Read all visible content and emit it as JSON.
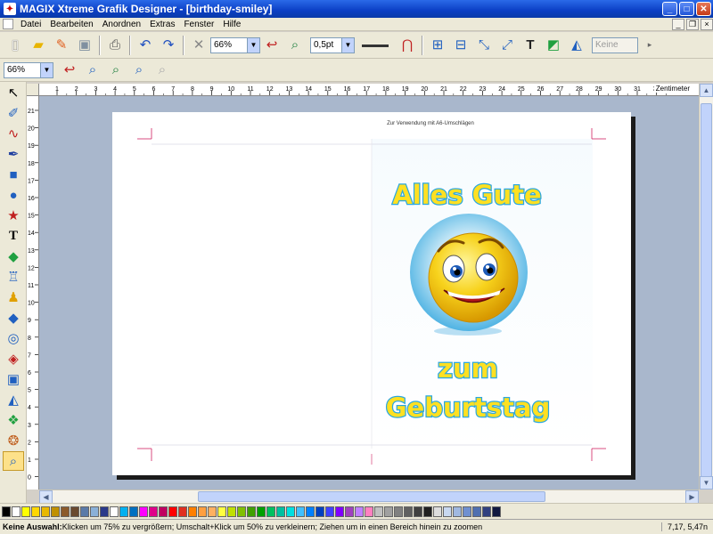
{
  "window": {
    "title": "MAGIX Xtreme Grafik Designer - [birthday-smiley]"
  },
  "menu": {
    "items": [
      "Datei",
      "Bearbeiten",
      "Anordnen",
      "Extras",
      "Fenster",
      "Hilfe"
    ]
  },
  "toolbar1": {
    "zoom": "66%",
    "line_width": "0,5pt",
    "style": "Keine"
  },
  "toolbar2": {
    "zoom": "66%"
  },
  "ruler": {
    "unit": "Zentimeter",
    "h_ticks": [
      "1",
      "2",
      "3",
      "4",
      "5",
      "6",
      "7",
      "8",
      "9",
      "10",
      "11",
      "12",
      "13",
      "14",
      "15",
      "16",
      "17",
      "18",
      "19",
      "20",
      "21",
      "22",
      "23",
      "24",
      "25",
      "26",
      "27",
      "28",
      "29",
      "30",
      "31",
      "32"
    ],
    "v_ticks": [
      "21",
      "20",
      "19",
      "18",
      "17",
      "16",
      "15",
      "14",
      "13",
      "12",
      "11",
      "10",
      "9",
      "8",
      "7",
      "6",
      "5",
      "4",
      "3",
      "2",
      "1",
      "0"
    ]
  },
  "document": {
    "header_note": "Zur Verwendung mit A6-Umschlägen",
    "line1": "Alles Gute",
    "line2": "zum",
    "line3": "Geburtstag"
  },
  "palette": {
    "colors": [
      "#000000",
      "#ffffff",
      "#ffff00",
      "#ffd700",
      "#e8b800",
      "#c09000",
      "#8b5a2b",
      "#6a4a30",
      "#5a7aa8",
      "#8ab0d8",
      "#2a3a8a",
      "#ffffff",
      "#00b0f0",
      "#0070c0",
      "#ff00ff",
      "#e0008a",
      "#c00060",
      "#ff0000",
      "#e03020",
      "#ff7f00",
      "#ff9f40",
      "#ffb060",
      "#ffff40",
      "#c0e000",
      "#80c000",
      "#40a000",
      "#00a000",
      "#00c060",
      "#00c0a0",
      "#00e0e0",
      "#40c0ff",
      "#0080ff",
      "#0040c0",
      "#4040ff",
      "#8000ff",
      "#a040c0",
      "#c080ff",
      "#ff80c0",
      "#c0c0c0",
      "#a0a0a0",
      "#808080",
      "#606060",
      "#404040",
      "#202020",
      "#dddddd",
      "#c8d8f0",
      "#a0b8e0",
      "#7090d0",
      "#5070b0",
      "#304080",
      "#101840"
    ]
  },
  "status": {
    "label": "Keine Auswahl:",
    "text": " Klicken um 75% zu vergrößern; Umschalt+Klick um 50% zu verkleinern; Ziehen um in einen Bereich hinein zu zoomen",
    "coords": "7,17, 5,47n"
  }
}
